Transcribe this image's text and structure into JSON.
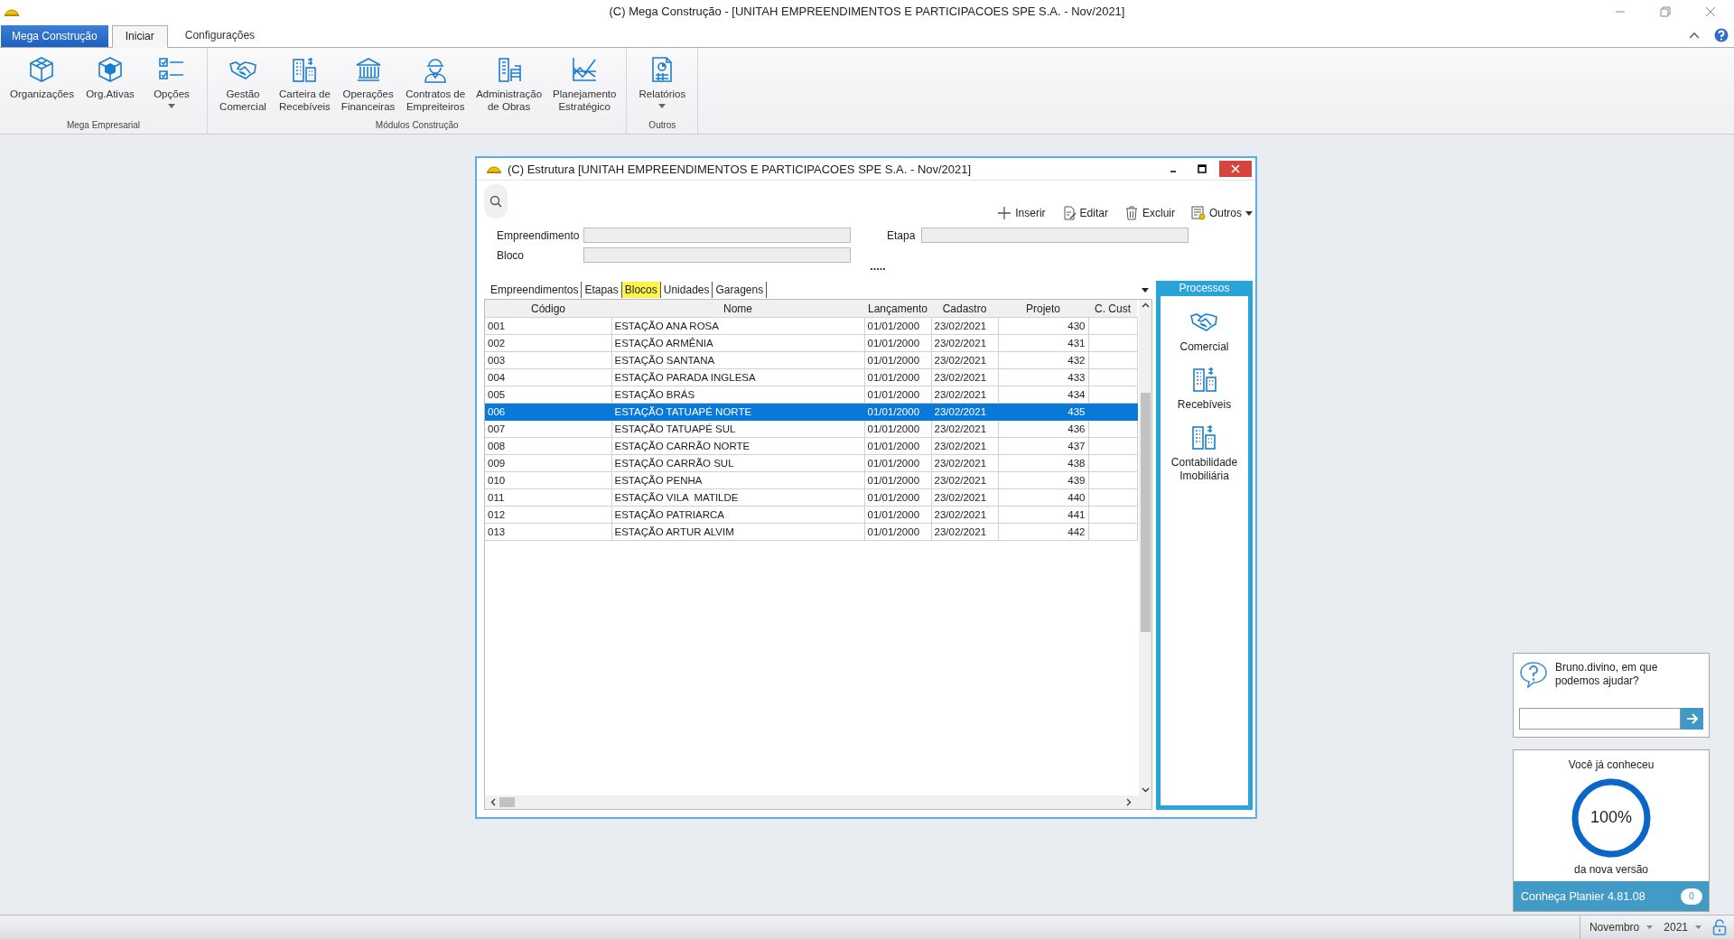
{
  "window": {
    "title": "(C)  Mega Construção - [UNITAH EMPREENDIMENTOS E PARTICIPACOES SPE S.A. - Nov/2021]"
  },
  "app_menu": {
    "label": "Mega Construção"
  },
  "ribbon_tabs": [
    {
      "label": "Iniciar",
      "selected": true
    },
    {
      "label": "Configurações",
      "selected": false
    }
  ],
  "ribbon_groups": [
    {
      "label": "Mega Empresarial",
      "buttons": [
        {
          "label": "Organizações",
          "dropdown": false
        },
        {
          "label": "Org.Ativas",
          "dropdown": false
        },
        {
          "label": "Opções",
          "dropdown": true
        }
      ]
    },
    {
      "label": "Módulos Construção",
      "buttons": [
        {
          "label": "Gestão\nComercial",
          "dropdown": false
        },
        {
          "label": "Carteira de\nRecebíveis",
          "dropdown": false
        },
        {
          "label": "Operações\nFinanceiras",
          "dropdown": false
        },
        {
          "label": "Contratos de\nEmpreiteiros",
          "dropdown": false
        },
        {
          "label": "Administração\nde Obras",
          "dropdown": false
        },
        {
          "label": "Planejamento\nEstratégico",
          "dropdown": false
        }
      ]
    },
    {
      "label": "Outros",
      "buttons": [
        {
          "label": "Relatórios",
          "dropdown": true
        }
      ]
    }
  ],
  "dialog": {
    "title": "(C) Estrutura [UNITAH EMPREENDIMENTOS E PARTICIPACOES SPE S.A. - Nov/2021]",
    "actions": [
      {
        "label": "Inserir",
        "dropdown": false
      },
      {
        "label": "Editar",
        "dropdown": false
      },
      {
        "label": "Excluir",
        "dropdown": false
      },
      {
        "label": "Outros",
        "dropdown": true
      }
    ],
    "filters_left": [
      {
        "label": "Empreendimento"
      },
      {
        "label": "Bloco"
      }
    ],
    "filters_right": [
      {
        "label": "Etapa"
      }
    ],
    "tabs": [
      {
        "label": "Empreendimentos",
        "selected": false
      },
      {
        "label": "Etapas",
        "selected": false
      },
      {
        "label": "Blocos",
        "selected": true
      },
      {
        "label": "Unidades",
        "selected": false
      },
      {
        "label": "Garagens",
        "selected": false
      }
    ],
    "grid": {
      "columns": [
        {
          "label": "Código"
        },
        {
          "label": "Nome"
        },
        {
          "label": "Lançamento"
        },
        {
          "label": "Cadastro"
        },
        {
          "label": "Projeto"
        },
        {
          "label": "C. Cust"
        }
      ],
      "rows": [
        {
          "cells": [
            "001",
            "ESTAÇÃO ANA ROSA",
            "01/01/2000",
            "23/02/2021",
            "430",
            ""
          ],
          "selected": false
        },
        {
          "cells": [
            "002",
            "ESTAÇÃO ARMÊNIA",
            "01/01/2000",
            "23/02/2021",
            "431",
            ""
          ],
          "selected": false
        },
        {
          "cells": [
            "003",
            "ESTAÇÃO SANTANA",
            "01/01/2000",
            "23/02/2021",
            "432",
            ""
          ],
          "selected": false
        },
        {
          "cells": [
            "004",
            "ESTAÇÃO PARADA INGLESA",
            "01/01/2000",
            "23/02/2021",
            "433",
            ""
          ],
          "selected": false
        },
        {
          "cells": [
            "005",
            "ESTAÇÃO BRÁS",
            "01/01/2000",
            "23/02/2021",
            "434",
            ""
          ],
          "selected": false
        },
        {
          "cells": [
            "006",
            "ESTAÇÃO TATUAPÉ NORTE",
            "01/01/2000",
            "23/02/2021",
            "435",
            ""
          ],
          "selected": true
        },
        {
          "cells": [
            "007",
            "ESTAÇÃO TATUAPÉ SUL",
            "01/01/2000",
            "23/02/2021",
            "436",
            ""
          ],
          "selected": false
        },
        {
          "cells": [
            "008",
            "ESTAÇÃO CARRÃO NORTE",
            "01/01/2000",
            "23/02/2021",
            "437",
            ""
          ],
          "selected": false
        },
        {
          "cells": [
            "009",
            "ESTAÇÃO CARRÃO SUL",
            "01/01/2000",
            "23/02/2021",
            "438",
            ""
          ],
          "selected": false
        },
        {
          "cells": [
            "010",
            "ESTAÇÃO PENHA",
            "01/01/2000",
            "23/02/2021",
            "439",
            ""
          ],
          "selected": false
        },
        {
          "cells": [
            "011",
            "ESTAÇÃO VILA  MATILDE",
            "01/01/2000",
            "23/02/2021",
            "440",
            ""
          ],
          "selected": false
        },
        {
          "cells": [
            "012",
            "ESTAÇÃO PATRIARCA",
            "01/01/2000",
            "23/02/2021",
            "441",
            ""
          ],
          "selected": false
        },
        {
          "cells": [
            "013",
            "ESTAÇÃO ARTUR ALVIM",
            "01/01/2000",
            "23/02/2021",
            "442",
            ""
          ],
          "selected": false
        }
      ]
    },
    "side_panel": {
      "title": "Processos",
      "items": [
        {
          "label": "Comercial"
        },
        {
          "label": "Recebíveis"
        },
        {
          "label": "Contabilidade\nImobiliária"
        }
      ]
    }
  },
  "help_widget": {
    "message": "Bruno.divino, em que podemos ajudar?"
  },
  "version_widget": {
    "heading": "Você já conheceu",
    "percent": "100%",
    "level": 1,
    "caption": "da nova versão",
    "footer": "Conheça Planier 4.81.08",
    "badge": "0"
  },
  "status_bar": {
    "month": "Novembro",
    "year": "2021"
  }
}
